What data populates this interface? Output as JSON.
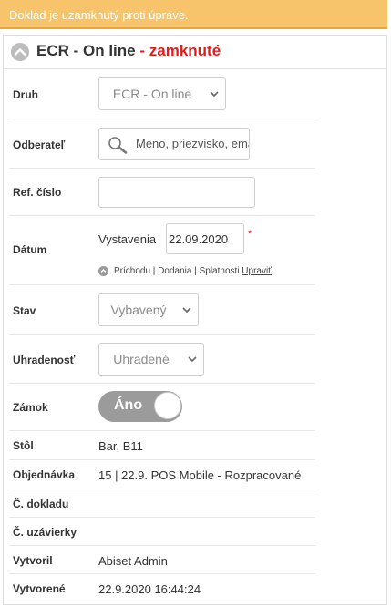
{
  "banner": {
    "text": "Doklad je uzamknutý proti úprave."
  },
  "header": {
    "title": "ECR - On line",
    "status": "- zamknuté",
    "icon": "chevron-up-icon"
  },
  "fields": {
    "druh": {
      "label": "Druh",
      "value": "ECR - On line"
    },
    "odberatel": {
      "label": "Odberateľ",
      "placeholder": "Meno, priezvisko, email"
    },
    "ref": {
      "label": "Ref. číslo",
      "value": ""
    },
    "datum": {
      "label": "Dátum",
      "sublabel": "Vystavenia",
      "value": "22.09.2020",
      "required_mark": "*",
      "links": "Príchodu | Dodania | Splatnosti",
      "edit_link": "Upraviť"
    },
    "stav": {
      "label": "Stav",
      "value": "Vybavený"
    },
    "uhradenost": {
      "label": "Uhradenosť",
      "value": "Uhradené"
    },
    "zamok": {
      "label": "Zámok",
      "toggle_label": "Áno",
      "on": true
    },
    "stol": {
      "label": "Stôl",
      "value": "Bar, B11"
    },
    "objednavka": {
      "label": "Objednávka",
      "value": "15 | 22.9. POS Mobile - Rozpracované"
    },
    "doklad": {
      "label": "Č. dokladu",
      "value": ""
    },
    "uzavierka": {
      "label": "Č. uzávierky",
      "value": ""
    },
    "vytvoril": {
      "label": "Vytvoril",
      "value": "Abiset Admin"
    },
    "vytvorene": {
      "label": "Vytvorené",
      "value": "22.9.2020 16:44:24"
    }
  },
  "colors": {
    "banner": "#f7c46c",
    "locked": "#e41b1b",
    "toggle": "#9b9b9b",
    "required": "#e41b1b"
  }
}
